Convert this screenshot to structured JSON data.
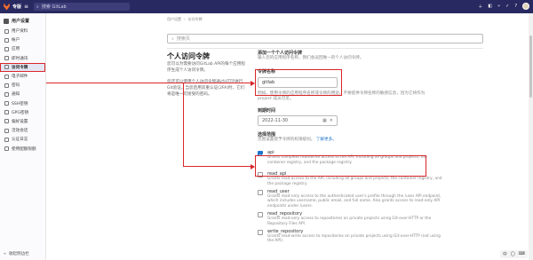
{
  "topbar": {
    "brand": "专版",
    "search_placeholder": "搜索 GitLab"
  },
  "sidebar": {
    "title": "用户设置",
    "items": [
      {
        "label": "用户资料"
      },
      {
        "label": "帐户"
      },
      {
        "label": "应用"
      },
      {
        "label": "即时通讯"
      },
      {
        "label": "访问令牌",
        "active": true
      },
      {
        "label": "电子邮件"
      },
      {
        "label": "密码"
      },
      {
        "label": "通知"
      },
      {
        "label": "SSH密钥"
      },
      {
        "label": "GPG密钥"
      },
      {
        "label": "偏好设置"
      },
      {
        "label": "活动会话"
      },
      {
        "label": "认证日志"
      },
      {
        "label": "使用配额限额"
      }
    ],
    "collapse_label": "收起侧边栏"
  },
  "breadcrumb": {
    "root": "用户设置",
    "current": "访问令牌"
  },
  "settings_search_placeholder": "搜索页",
  "left": {
    "title": "个人访问令牌",
    "desc1": "您可以为需要访问GitLab API的每个应用程序生成个人访问令牌。",
    "desc2": "您还可以使用个人访问令牌通过HTTP进行Git验证。当您启用双重认证(2FA)时，它们将是唯一可接受的密码。"
  },
  "form": {
    "section_title": "添加一个个人访问令牌",
    "section_help": "输入您的应用程序名称，我们会返回唯一的个人访问令牌。",
    "name_label": "令牌名称",
    "name_value": "gitlab",
    "name_help": "例如，使用令牌的应用程序名称或令牌的用途。不要提供令牌名称的敏感信息，因为它将作为 project 成员可见。",
    "expire_label": "到期时间",
    "expire_value": "2022-11-30",
    "scopes_label": "选择范围",
    "scopes_help": "范围设置授予令牌的权限级别。",
    "scopes_link": "了解更多。",
    "scopes": [
      {
        "name": "api",
        "checked": true,
        "desc": "Grants complete read/write access to the API, including all groups and projects, the container registry, and the package registry."
      },
      {
        "name": "read_api",
        "checked": false,
        "desc": "Grants read access to the API, including all groups and projects, the container registry, and the package registry."
      },
      {
        "name": "read_user",
        "checked": false,
        "desc": "Grants read-only access to the authenticated user's profile through the /user API endpoint, which includes username, public email, and full name. Also grants access to read-only API endpoints under /users."
      },
      {
        "name": "read_repository",
        "checked": false,
        "desc": "Grants read-only access to repositories on private projects using Git-over-HTTP or the Repository Files API."
      },
      {
        "name": "write_repository",
        "checked": false,
        "desc": "Grants read-write access to repositories on private projects using Git-over-HTTP (not using the API)."
      }
    ]
  },
  "tray": {
    "items": [
      "中",
      "〇",
      "⌨"
    ]
  },
  "colors": {
    "topbar": "#292961",
    "accent": "#1f75cb",
    "annotation": "#d9262b"
  }
}
